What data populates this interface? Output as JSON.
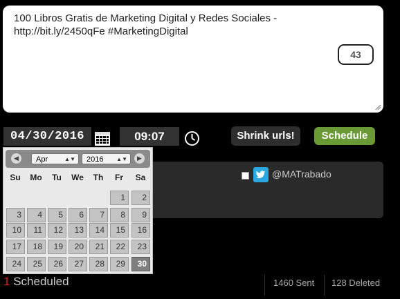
{
  "compose": {
    "text": "100 Libros Gratis de Marketing Digital y Redes Sociales -\nhttp://bit.ly/2450qFe #MarketingDigital",
    "char_count": "43"
  },
  "schedule": {
    "date": "04/30/2016",
    "time": "09:07",
    "shrink_label": "Shrink urls!",
    "schedule_label": "Schedule"
  },
  "account": {
    "name": "@MATrabado",
    "checked": false,
    "icon": "twitter-bird-icon"
  },
  "datepicker": {
    "month": "Apr",
    "year": "2016",
    "weekdays": [
      "Su",
      "Mo",
      "Tu",
      "We",
      "Th",
      "Fr",
      "Sa"
    ],
    "weeks": [
      [
        null,
        null,
        null,
        null,
        null,
        "1",
        "2"
      ],
      [
        "3",
        "4",
        "5",
        "6",
        "7",
        "8",
        "9"
      ],
      [
        "10",
        "11",
        "12",
        "13",
        "14",
        "15",
        "16"
      ],
      [
        "17",
        "18",
        "19",
        "20",
        "21",
        "22",
        "23"
      ],
      [
        "24",
        "25",
        "26",
        "27",
        "28",
        "29",
        "30"
      ]
    ],
    "selected_day": "30"
  },
  "footer": {
    "scheduled_number": "1",
    "scheduled_label": " Scheduled",
    "sent": "1460 Sent",
    "deleted": "128 Deleted"
  },
  "colors": {
    "schedule_green": "#6a9a35",
    "scheduled_count_red": "#d21f1f",
    "twitter_blue": "#2aa9e0"
  }
}
